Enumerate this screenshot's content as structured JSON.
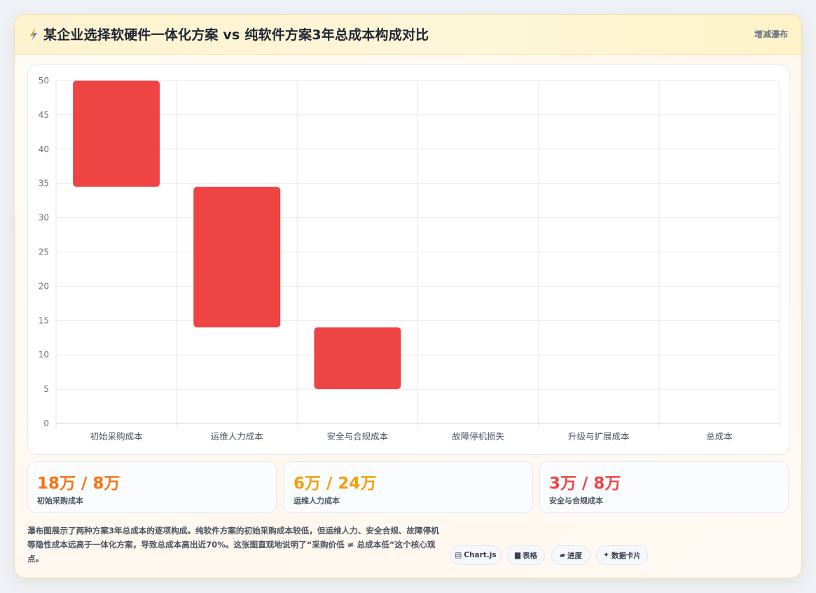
{
  "header": {
    "icon": "lightning-icon",
    "title": "某企业选择软硬件一体化方案 vs 纯软件方案3年总成本构成对比",
    "tag": "增减瀑布"
  },
  "colors": {
    "bar": "#ef4444",
    "accent_orange": "#f97316",
    "accent_amber": "#f59e0b",
    "accent_red": "#ef4444"
  },
  "chart_data": {
    "type": "bar",
    "subtype": "waterfall",
    "categories": [
      "初始采购成本",
      "运维人力成本",
      "安全与合规成本",
      "故障停机损失",
      "升级与扩展成本",
      "总成本"
    ],
    "floating_ranges": [
      [
        34.5,
        50
      ],
      [
        14,
        34.5
      ],
      [
        5,
        14
      ],
      null,
      null,
      null
    ],
    "y_ticks": [
      0,
      5,
      10,
      15,
      20,
      25,
      30,
      35,
      40,
      45,
      50
    ],
    "ylim": [
      0,
      50
    ],
    "grid": true,
    "legend": "none",
    "title": "",
    "xlabel": "",
    "ylabel": ""
  },
  "stats": [
    {
      "value": "18万 / 8万",
      "label": "初始采购成本"
    },
    {
      "value": "6万 / 24万",
      "label": "运维人力成本"
    },
    {
      "value": "3万 / 8万",
      "label": "安全与合规成本"
    }
  ],
  "description": "瀑布图展示了两种方案3年总成本的逐项构成。纯软件方案的初始采购成本较低，但运维人力、安全合规、故障停机等隐性成本远高于一体化方案，导致总成本高出近70%。这张图直观地说明了“采购价低 ≠ 总成本低”这个核心观点。",
  "pills": [
    {
      "icon": "clipboard-icon",
      "glyph": "▤",
      "label": "Chart.js"
    },
    {
      "icon": "table-icon",
      "glyph": "▆",
      "label": "表格"
    },
    {
      "icon": "progress-icon",
      "glyph": "▰",
      "label": "进度"
    },
    {
      "icon": "sparkle-icon",
      "glyph": "✦",
      "label": "数据卡片"
    }
  ]
}
